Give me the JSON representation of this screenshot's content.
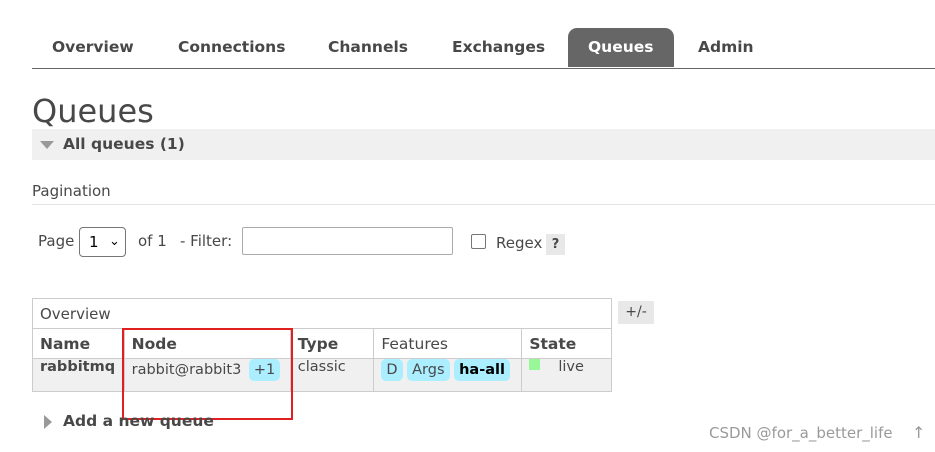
{
  "nav": {
    "tabs": [
      {
        "label": "Overview"
      },
      {
        "label": "Connections"
      },
      {
        "label": "Channels"
      },
      {
        "label": "Exchanges"
      },
      {
        "label": "Queues",
        "active": true
      },
      {
        "label": "Admin"
      }
    ]
  },
  "page_title": "Queues",
  "section": {
    "label": "All queues (1)"
  },
  "pagination": {
    "heading": "Pagination",
    "page_label": "Page",
    "page_value": "1",
    "of_label": "of 1",
    "filter_label": "- Filter:",
    "filter_value": "",
    "regex_label": "Regex",
    "regex_checked": false,
    "help_label": "?"
  },
  "table": {
    "group_label": "Overview",
    "toggle_columns_label": "+/-",
    "headers": [
      "Name",
      "Node",
      "Type",
      "Features",
      "State"
    ],
    "rows": [
      {
        "name": "rabbitmq",
        "node": "rabbit@rabbit3",
        "node_extra": "+1",
        "type": "classic",
        "features": [
          "D",
          "Args",
          "ha-all"
        ],
        "state": "live",
        "state_color": "#98f898"
      }
    ]
  },
  "add_queue_label": "Add a new queue",
  "watermark": "CSDN @for_a_better_life",
  "colors": {
    "active_tab_bg": "#666666",
    "feature_pill_bg": "#aaeeff",
    "highlight_box": "#e02020"
  }
}
